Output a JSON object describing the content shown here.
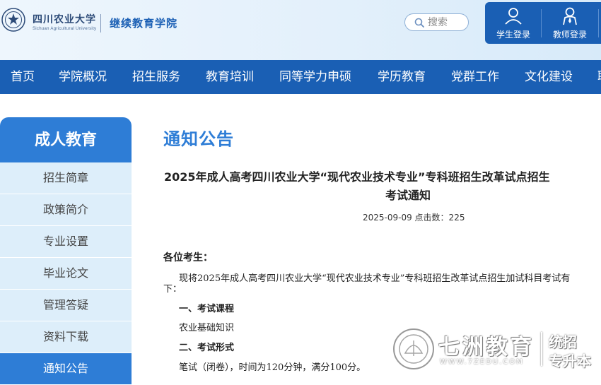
{
  "header": {
    "university_name": "四川农业大学",
    "university_en": "Sichuan Agricultural University",
    "college_name": "继续教育学院",
    "search": {
      "placeholder": "搜索"
    },
    "login": {
      "student": "学生登录",
      "teacher": "教师登录"
    }
  },
  "nav": {
    "items": [
      "首页",
      "学院概况",
      "招生服务",
      "教育培训",
      "同等学力申硕",
      "学历教育",
      "党群工作",
      "文化建设"
    ]
  },
  "sidebar": {
    "title": "成人教育",
    "items": [
      {
        "label": "招生简章",
        "active": false
      },
      {
        "label": "政策简介",
        "active": false
      },
      {
        "label": "专业设置",
        "active": false
      },
      {
        "label": "毕业论文",
        "active": false
      },
      {
        "label": "管理答疑",
        "active": false
      },
      {
        "label": "资料下载",
        "active": false
      },
      {
        "label": "通知公告",
        "active": true
      }
    ]
  },
  "main": {
    "section_title": "通知公告",
    "article": {
      "title_line1": "2025年成人高考四川农业大学“现代农业技术专业”专科班招生改革试点招生",
      "title_line2": "考试通知",
      "meta": "2025-09-09 点击数：225",
      "greeting": "各位考生：",
      "intro_line1": "现将2025年成人高考四川农业大学“现代农业技术专业”专科班招生改革试点招生加试科目考试有",
      "intro_line2": "下：",
      "heading_course": "一、考试课程",
      "course_text": "农业基础知识",
      "heading_form": "二、考试形式",
      "form_text": "笔试（闭卷），时间为120分钟，满分100分。"
    }
  },
  "watermark": {
    "name": "七洲教育",
    "url": "WWW.7ZEDU.COM",
    "right_line1": "统招",
    "right_line2": "专升本"
  },
  "colors": {
    "primary": "#1a5fb4",
    "accent": "#2e7dd6",
    "sidebar_item_bg": "#ddeefa"
  }
}
